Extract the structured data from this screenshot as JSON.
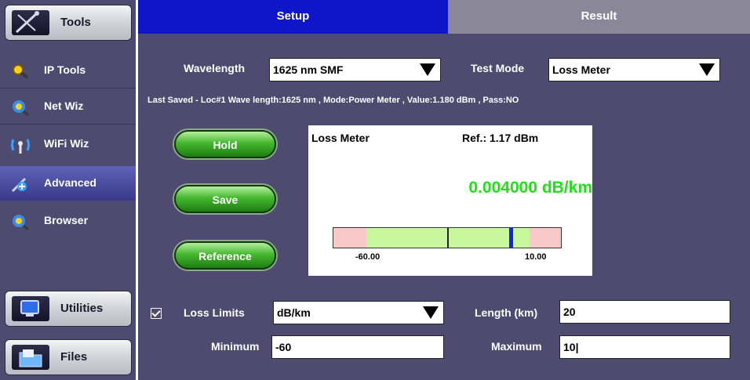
{
  "sidebar": {
    "tools_label": "Tools",
    "items": [
      {
        "label": "IP Tools",
        "icon": "magnifier-icon"
      },
      {
        "label": "Net Wiz",
        "icon": "globe-magnifier-icon"
      },
      {
        "label": "WiFi Wiz",
        "icon": "antenna-icon"
      },
      {
        "label": "Advanced",
        "icon": "advanced-tool-icon"
      },
      {
        "label": "Browser",
        "icon": "globe-magnifier-icon"
      }
    ],
    "utilities_label": "Utilities",
    "files_label": "Files"
  },
  "tabs": {
    "setup": "Setup",
    "result": "Result"
  },
  "form": {
    "wavelength_label": "Wavelength",
    "wavelength_value": "1625 nm SMF",
    "test_mode_label": "Test Mode",
    "test_mode_value": "Loss Meter",
    "last_saved": "Last Saved - Loc#1 Wave length:1625 nm , Mode:Power Meter , Value:1.180 dBm , Pass:NO",
    "loss_limits_label": "Loss Limits",
    "loss_limits_checked": true,
    "units_value": "dB/km",
    "length_label": "Length (km)",
    "length_value": "20",
    "minimum_label": "Minimum",
    "minimum_value": "-60",
    "maximum_label": "Maximum",
    "maximum_value": "10|"
  },
  "buttons": {
    "hold": "Hold",
    "save": "Save",
    "reference": "Reference"
  },
  "meter": {
    "title": "Loss Meter",
    "ref": "Ref.: 1.17 dBm",
    "value": "0.004000 dB/km",
    "scale_min_label": "-60.00",
    "scale_max_label": "10.00"
  },
  "colors": {
    "panel_bg": "#4f4a70",
    "setup_tab": "#0f15c9",
    "result_tab": "#8a8898",
    "reading_green": "#22e01a",
    "pass_zone": "#c8f79e",
    "fail_zone": "#f9c9c9",
    "needle": "#1226e0"
  }
}
